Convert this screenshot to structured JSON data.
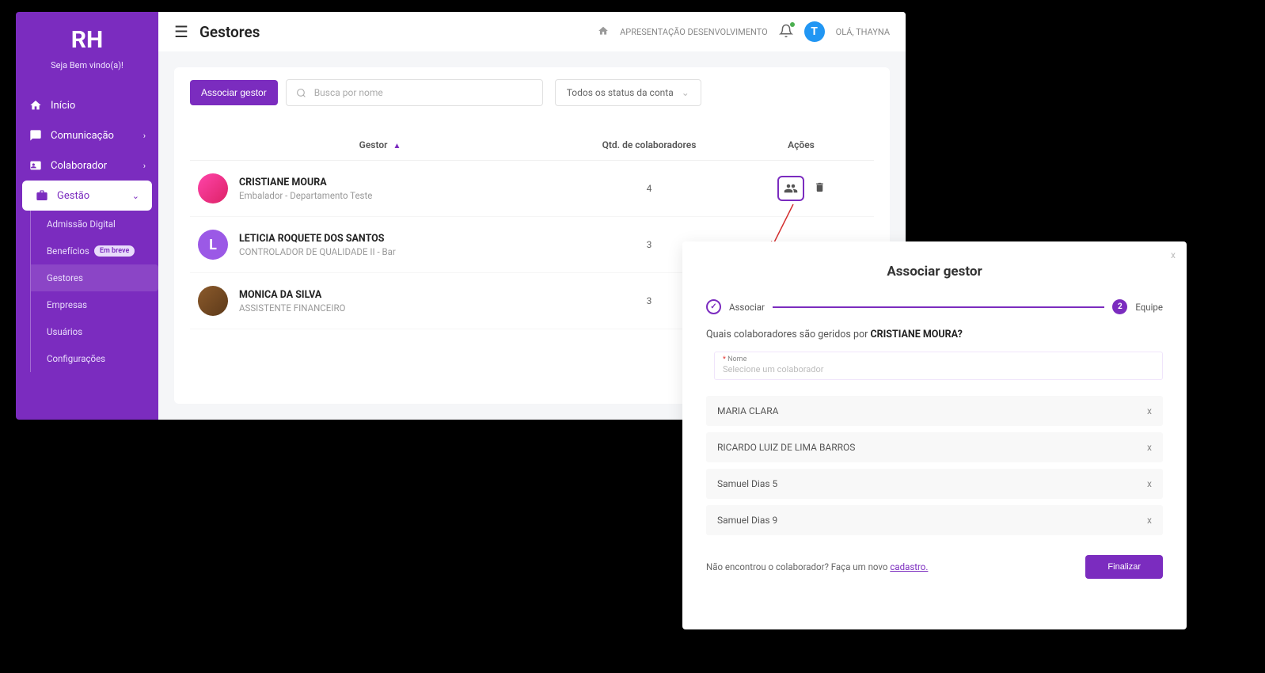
{
  "sidebar": {
    "logo": "RH",
    "welcome": "Seja Bem vindo(a)!",
    "items": {
      "inicio": "Início",
      "comunicacao": "Comunicação",
      "colaborador": "Colaborador",
      "gestao": "Gestão"
    },
    "submenu": {
      "admissao": "Admissão Digital",
      "beneficios": "Benefícios",
      "beneficios_badge": "Em breve",
      "gestores": "Gestores",
      "empresas": "Empresas",
      "usuarios": "Usuários",
      "config": "Configurações"
    }
  },
  "topbar": {
    "title": "Gestores",
    "breadcrumb": "APRESENTAÇÃO DESENVOLVIMENTO",
    "avatar_letter": "T",
    "greeting": "OLÁ, THAYNA"
  },
  "filters": {
    "associate_btn": "Associar gestor",
    "search_placeholder": "Busca por nome",
    "status_dropdown": "Todos os status da conta"
  },
  "table": {
    "headers": {
      "gestor": "Gestor",
      "qtd": "Qtd. de colaboradores",
      "acoes": "Ações"
    },
    "rows": [
      {
        "name": "CRISTIANE MOURA",
        "sub": "Embalador - Departamento Teste",
        "qty": "4",
        "avatar_type": "img1",
        "avatar_label": ""
      },
      {
        "name": "LETICIA ROQUETE DOS SANTOS",
        "sub": "CONTROLADOR DE QUALIDADE II - Bar",
        "qty": "3",
        "avatar_type": "letter",
        "avatar_label": "L"
      },
      {
        "name": "MONICA DA SILVA",
        "sub": "ASSISTENTE FINANCEIRO",
        "qty": "3",
        "avatar_type": "img2",
        "avatar_label": ""
      }
    ]
  },
  "modal": {
    "title": "Associar gestor",
    "step1": "Associar",
    "step2_num": "2",
    "step2": "Equipe",
    "question_pre": "Quais colaboradores são geridos por ",
    "question_name": "CRISTIANE MOURA?",
    "input_label": "Nome",
    "input_placeholder": "Selecione um colaborador",
    "collaborators": [
      "MARIA CLARA",
      "RICARDO LUIZ DE LIMA BARROS",
      "Samuel Dias 5",
      "Samuel Dias 9"
    ],
    "hint_pre": "Não encontrou o colaborador? Faça um novo ",
    "hint_link": "cadastro.",
    "finalize": "Finalizar",
    "close": "x"
  }
}
